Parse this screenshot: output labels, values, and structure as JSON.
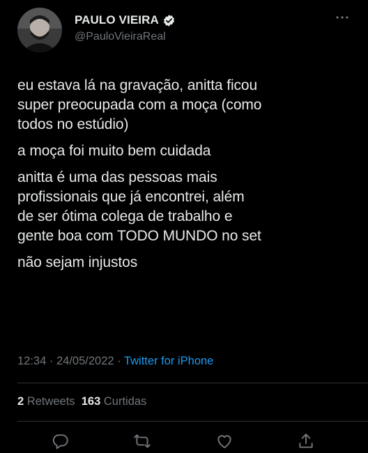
{
  "tweet": {
    "author": {
      "name": "PAULO VIEIRA",
      "handle": "@PauloVieiraReal",
      "verified": true
    },
    "paragraphs": [
      "eu estava lá na gravação, anitta ficou\nsuper preocupada com a moça (como\ntodos no estúdio)",
      "a moça foi muito bem cuidada",
      "anitta é uma das pessoas mais\nprofissionais que já encontrei, além\nde ser ótima colega de trabalho e\ngente boa com TODO MUNDO no set",
      "não sejam injustos"
    ],
    "time": "12:34",
    "date": "24/05/2022",
    "separator": "·",
    "source": "Twitter for iPhone",
    "retweets_count": "2",
    "retweets_label": "Retweets",
    "likes_count": "163",
    "likes_label": "Curtidas"
  },
  "icons": {
    "more": "more-horizontal-icon",
    "reply": "reply-icon",
    "retweet": "retweet-icon",
    "like": "heart-icon",
    "share": "share-icon",
    "verified": "verified-badge-icon"
  },
  "colors": {
    "background": "#000000",
    "text": "#e7e9ea",
    "muted": "#71767b",
    "link": "#1d9bf0",
    "divider": "#2f3336"
  }
}
